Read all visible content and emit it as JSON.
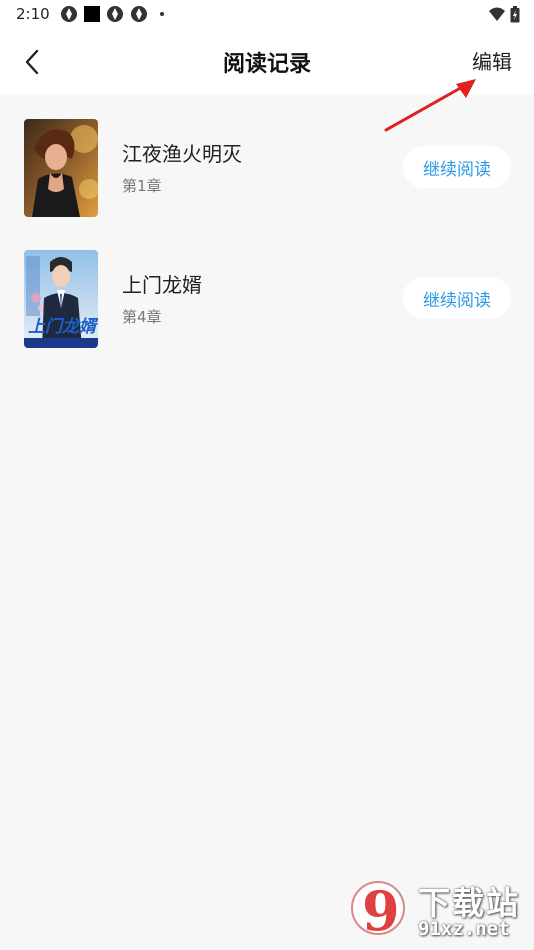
{
  "status_bar": {
    "time": "2:10"
  },
  "header": {
    "title": "阅读记录",
    "edit_label": "编辑"
  },
  "books": [
    {
      "title": "江夜渔火明灭",
      "chapter": "第1章",
      "action_label": "继续阅读"
    },
    {
      "title": "上门龙婿",
      "chapter": "第4章",
      "action_label": "继续阅读"
    }
  ],
  "covers": {
    "second_cover_text": "上门龙婿"
  },
  "watermark": {
    "text": "下载站",
    "site": "91xz.net",
    "logo_glyph": "9"
  },
  "colors": {
    "accent": "#2a9ae6",
    "annotation": "#e02020",
    "background": "#f7f7f7"
  }
}
